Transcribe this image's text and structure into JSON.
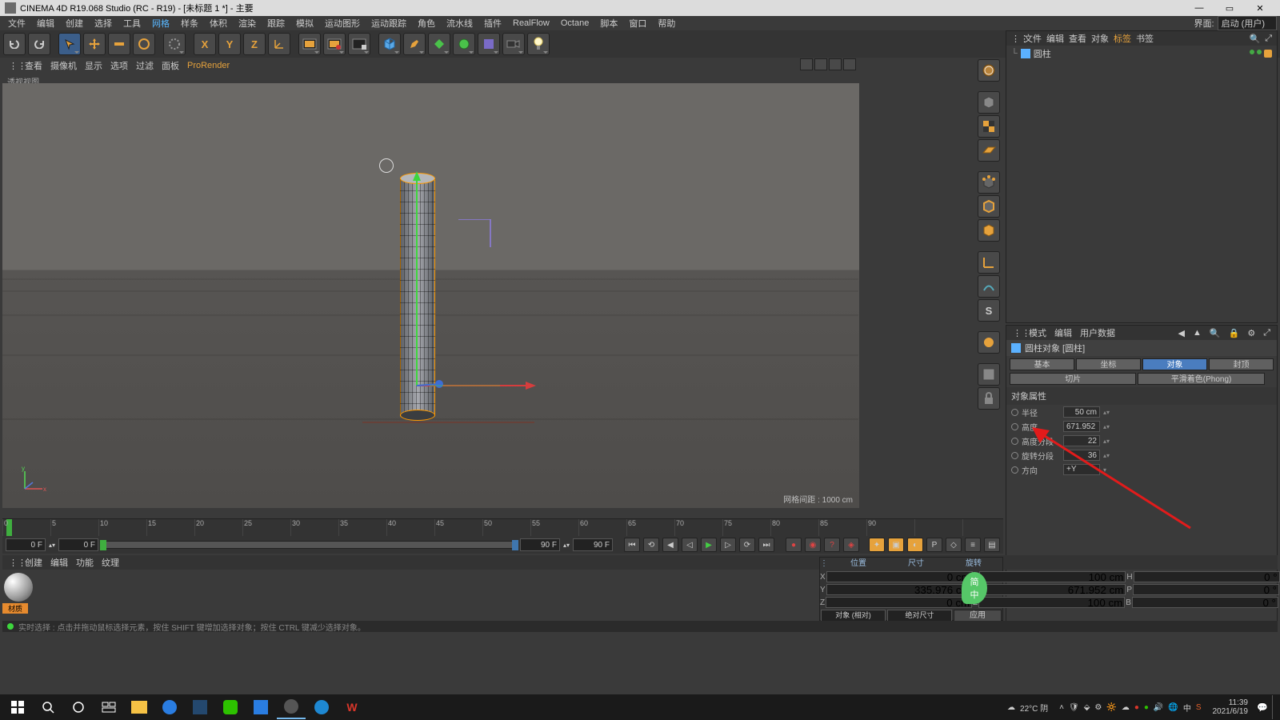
{
  "window": {
    "title": "CINEMA 4D R19.068 Studio (RC - R19) - [未标题 1 *] - 主要",
    "layout_label": "界面:",
    "layout_value": "启动 (用户)"
  },
  "menus": [
    "文件",
    "编辑",
    "创建",
    "选择",
    "工具",
    "网格",
    "样条",
    "体积",
    "渲染",
    "跟踪",
    "模拟",
    "运动图形",
    "运动跟踪",
    "角色",
    "流水线",
    "插件",
    "RealFlow",
    "Octane",
    "脚本",
    "窗口",
    "帮助"
  ],
  "viewport_menus": [
    "查看",
    "摄像机",
    "显示",
    "选项",
    "过滤",
    "面板",
    "ProRender"
  ],
  "viewport": {
    "label": "透视视图",
    "grid_info": "网格间距 : 1000 cm"
  },
  "objects_panel": {
    "tabs": [
      "文件",
      "编辑",
      "查看",
      "对象",
      "标签",
      "书签"
    ],
    "item_name": "圆柱"
  },
  "attr_panel": {
    "header_tabs": [
      "模式",
      "编辑",
      "用户数据"
    ],
    "object_title": "圆柱对象 [圆柱]",
    "tabs": [
      "基本",
      "坐标",
      "对象",
      "封顶"
    ],
    "tabs2": [
      "切片",
      "平滑着色(Phong)"
    ],
    "section": "对象属性",
    "props": {
      "radius_label": "半径",
      "radius_val": "50 cm",
      "height_label": "高度",
      "height_val": "671.952 c",
      "hseg_label": "高度分段",
      "hseg_val": "22",
      "rseg_label": "旋转分段",
      "rseg_val": "36",
      "orient_label": "方向",
      "orient_val": "+Y"
    }
  },
  "timeline": {
    "ticks": [
      "0",
      "5",
      "10",
      "15",
      "20",
      "25",
      "30",
      "35",
      "40",
      "45",
      "50",
      "55",
      "60",
      "65",
      "70",
      "75",
      "80",
      "85",
      "90"
    ],
    "start": "0 F",
    "end": "90 F",
    "start2": "0 F",
    "end2": "90 F"
  },
  "coord": {
    "headers": [
      "位置",
      "尺寸",
      "旋转"
    ],
    "x": {
      "pos": "0 cm",
      "size": "100 cm",
      "rot": "0 °",
      "deglbl": "H"
    },
    "y": {
      "pos": "335.976 cm",
      "size": "671.952 cm",
      "rot": "0 °",
      "deglbl": "P"
    },
    "z": {
      "pos": "0 cm",
      "size": "100 cm",
      "rot": "0 °",
      "deglbl": "B"
    },
    "mode1": "对象 (相对)",
    "mode2": "绝对尺寸",
    "apply": "应用"
  },
  "material": {
    "menus": [
      "创建",
      "编辑",
      "功能",
      "纹理"
    ],
    "name": "材质"
  },
  "statusline": "实时选择 : 点击并拖动鼠标选择元素，按住 SHIFT 键增加选择对象；按住 CTRL 键减少选择对象。",
  "system": {
    "weather": "22°C 阴",
    "time": "11:39",
    "date": "2021/6/19",
    "ime1": "简",
    "ime2": "中"
  }
}
